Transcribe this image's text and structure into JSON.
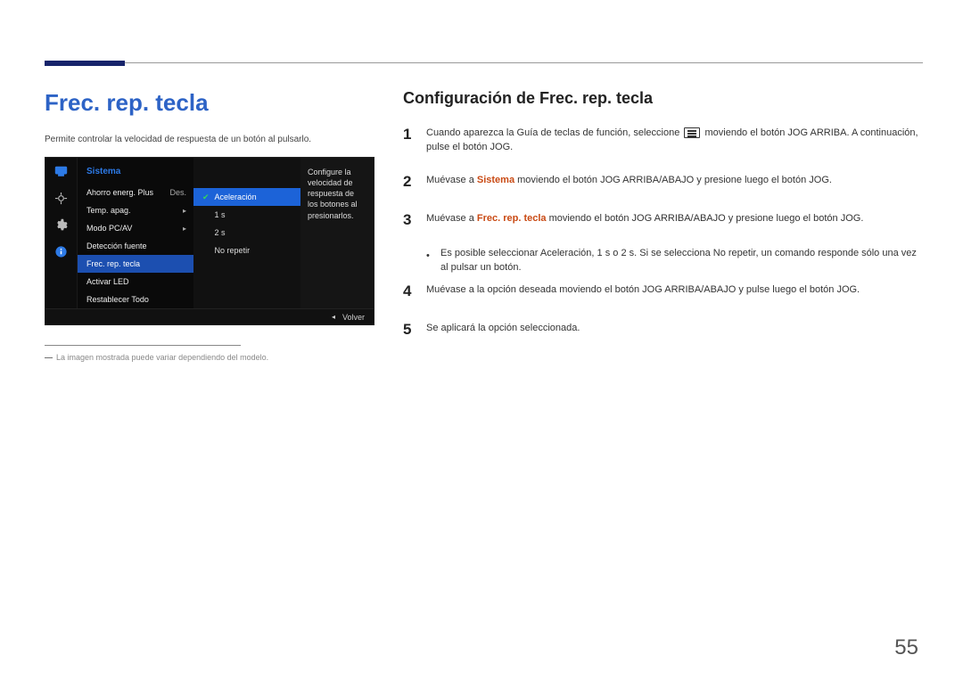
{
  "page_number": "55",
  "left": {
    "heading": "Frec. rep. tecla",
    "intro": "Permite controlar la velocidad de respuesta de un botón al pulsarlo.",
    "footnote": "La imagen mostrada puede variar dependiendo del modelo."
  },
  "osd": {
    "title": "Sistema",
    "items": [
      {
        "label": "Ahorro energ. Plus",
        "value": "Des."
      },
      {
        "label": "Temp. apag.",
        "arrow": "▸"
      },
      {
        "label": "Modo PC/AV",
        "arrow": "▸"
      },
      {
        "label": "Detección fuente"
      },
      {
        "label": "Frec. rep. tecla",
        "selected": true
      },
      {
        "label": "Activar LED"
      },
      {
        "label": "Restablecer Todo"
      }
    ],
    "sub_options": [
      {
        "label": "Aceleración",
        "selected": true
      },
      {
        "label": "1 s"
      },
      {
        "label": "2 s"
      },
      {
        "label": "No repetir"
      }
    ],
    "description": "Configure la velocidad de respuesta de los botones al presionarlos.",
    "footer_label": "Volver"
  },
  "right": {
    "heading": "Configuración de Frec. rep. tecla",
    "steps": {
      "1a": "Cuando aparezca la Guía de teclas de función, seleccione ",
      "1b": " moviendo el botón JOG ARRIBA. A continuación, pulse el botón JOG.",
      "2a": "Muévase a ",
      "2_sys": "Sistema",
      "2b": " moviendo el botón JOG ARRIBA/ABAJO y presione luego el botón JOG.",
      "3a": "Muévase a ",
      "3_frec": "Frec. rep. tecla",
      "3b": " moviendo el botón JOG ARRIBA/ABAJO y presione luego el botón JOG.",
      "b1a": "Es posible seleccionar ",
      "b1_acel": "Aceleración",
      "b1b": ", ",
      "b1_1s": "1 s",
      "b1c": " o ",
      "b1_2s": "2 s",
      "b1d": ". Si se selecciona ",
      "b1_nr": "No repetir",
      "b1e": ", un comando responde sólo una vez al pulsar un botón.",
      "4": "Muévase a la opción deseada moviendo el botón JOG ARRIBA/ABAJO y pulse luego el botón JOG.",
      "5": "Se aplicará la opción seleccionada.",
      "n1": "1",
      "n2": "2",
      "n3": "3",
      "n4": "4",
      "n5": "5"
    }
  }
}
